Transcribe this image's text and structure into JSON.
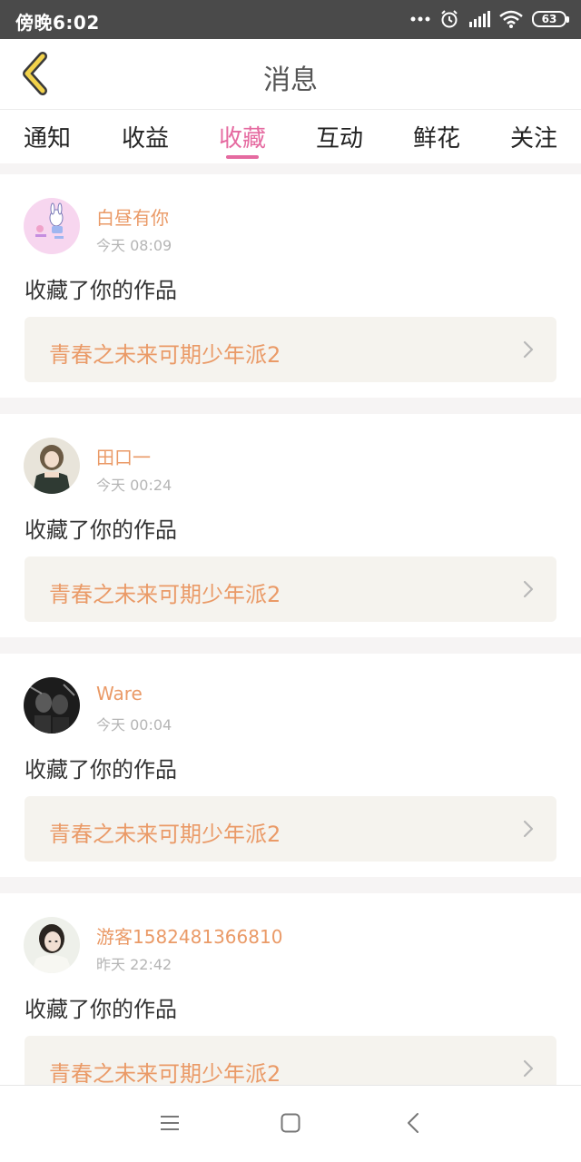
{
  "status_bar": {
    "time": "傍晚6:02",
    "battery": "63",
    "icons": [
      "more-dots-icon",
      "alarm-icon",
      "signal-icon",
      "wifi-icon",
      "battery-icon"
    ]
  },
  "header": {
    "title": "消息",
    "back_icon": "chevron-left-icon",
    "accent_color": "#f2d24b"
  },
  "tabs": [
    {
      "label": "通知",
      "active": false
    },
    {
      "label": "收益",
      "active": false
    },
    {
      "label": "收藏",
      "active": true
    },
    {
      "label": "互动",
      "active": false
    },
    {
      "label": "鲜花",
      "active": false
    },
    {
      "label": "关注",
      "active": false
    }
  ],
  "colors": {
    "active_tab": "#e56aa0",
    "username": "#ea9a67",
    "work_title": "#ea9a67",
    "timestamp": "#b5b5b5",
    "work_box_bg": "#f5f3ee"
  },
  "messages": [
    {
      "username": "白昼有你",
      "time": "今天 08:09",
      "action": "收藏了你的作品",
      "work_title": "青春之未来可期少年派2",
      "avatar": "bunny-avatar"
    },
    {
      "username": "田口一",
      "time": "今天 00:24",
      "action": "收藏了你的作品",
      "work_title": "青春之未来可期少年派2",
      "avatar": "girl-avatar"
    },
    {
      "username": "Ware",
      "time": "今天 00:04",
      "action": "收藏了你的作品",
      "work_title": "青春之未来可期少年派2",
      "avatar": "dark-photo-avatar"
    },
    {
      "username": "游客1582481366810",
      "time": "昨天 22:42",
      "action": "收藏了你的作品",
      "work_title": "青春之未来可期少年派2",
      "avatar": "portrait-avatar"
    }
  ],
  "nav_bar": {
    "items": [
      "menu-icon",
      "home-square-icon",
      "back-arrow-icon"
    ]
  }
}
